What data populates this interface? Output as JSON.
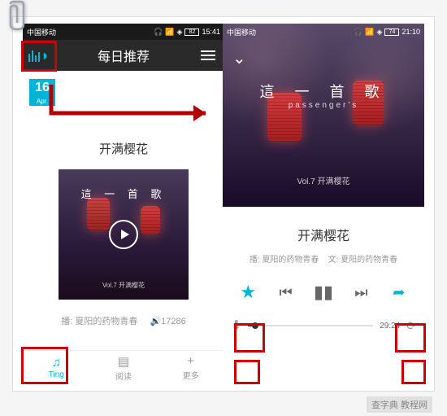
{
  "statusbar": {
    "carrier_left": "中国移动",
    "battery_left": "82",
    "time_left": "15:41",
    "carrier_right": "中国移动",
    "battery_right": "74",
    "time_right": "21:10"
  },
  "header": {
    "title": "每日推荐"
  },
  "date_badge": {
    "day": "16",
    "month": "Apr."
  },
  "left_screen": {
    "section_title": "开满樱花",
    "album_title": "這 一 首 歌",
    "album_subtitle": "Vol.7 开满樱花",
    "meta_author_label": "播",
    "meta_author": "夏阳的药物青春",
    "play_count": "17286"
  },
  "tabs": {
    "ting": "Ting",
    "read": "阅读",
    "more": "更多"
  },
  "right_screen": {
    "hero_title": "這 一 首 歌",
    "hero_subtitle": "passenger's",
    "hero_volume": "Vol.7 开满樱花",
    "title": "开满樱花",
    "meta_play_label": "播",
    "meta_play": "夏阳的药物青春",
    "meta_text_label": "文",
    "meta_text": "夏阳的药物青春",
    "time": "29:24"
  },
  "watermark": "查字典 教程网"
}
